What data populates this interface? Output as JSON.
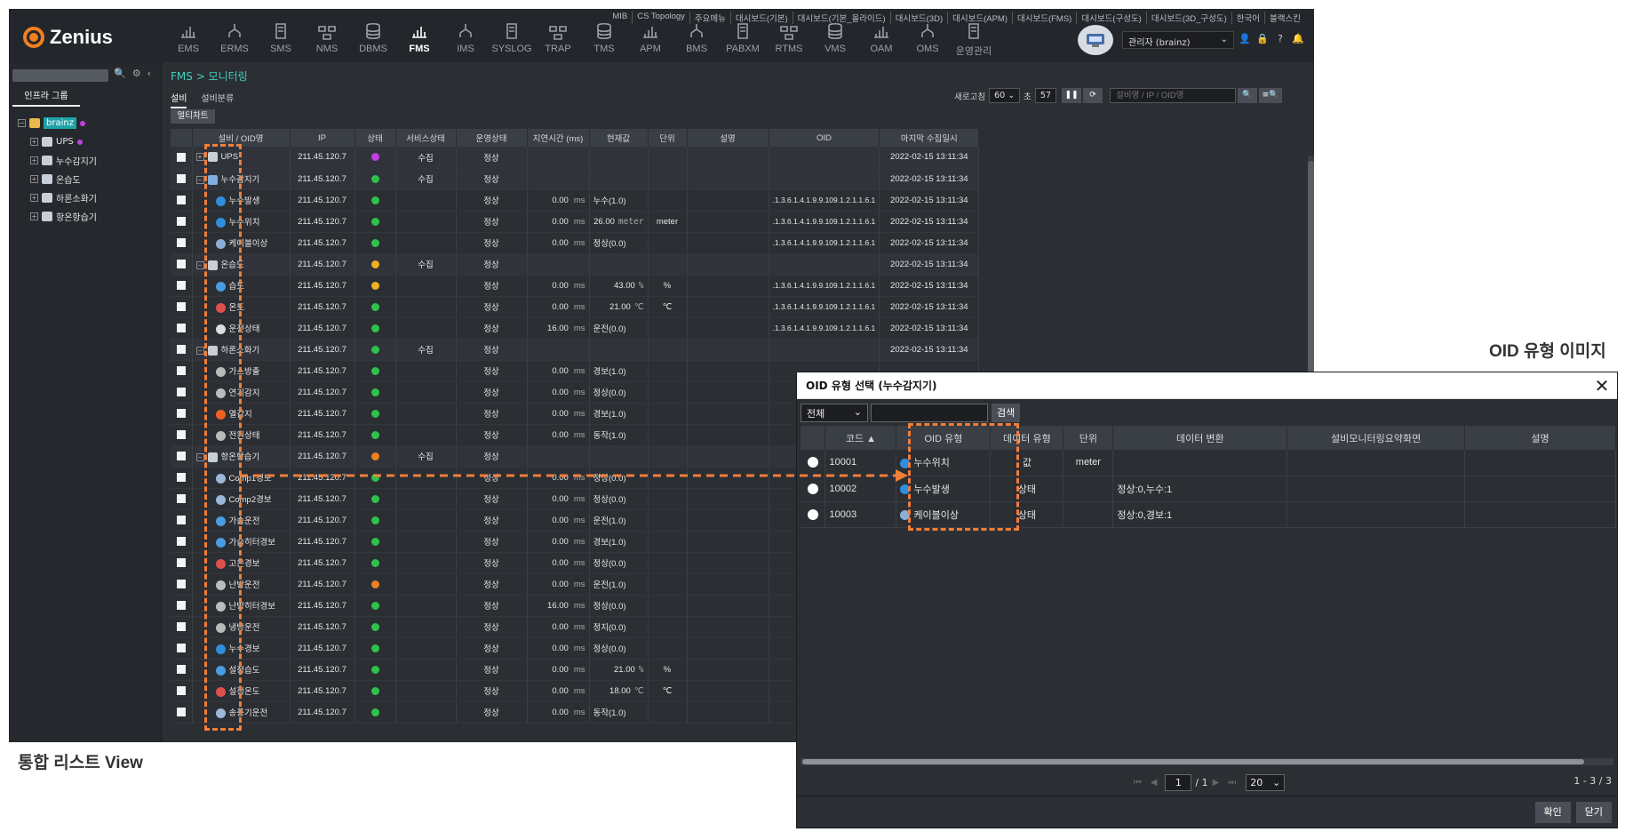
{
  "app": {
    "logo": "Zenius",
    "modules": [
      "EMS",
      "ERMS",
      "SMS",
      "NMS",
      "DBMS",
      "FMS",
      "IMS",
      "SYSLOG",
      "TRAP",
      "TMS",
      "APM",
      "BMS",
      "PABXM",
      "RTMS",
      "VMS",
      "OAM",
      "OMS",
      "운영관리"
    ],
    "active_module": "FMS",
    "top_links": [
      "MIB",
      "CS Topology",
      "주요메뉴",
      "대시보드(기본)",
      "대시보드(기본_올라이드)",
      "대시보드(3D)",
      "대시보드(APM)",
      "대시보드(FMS)",
      "대시보드(구성도)",
      "대시보드(3D_구성도)",
      "한국어",
      "블랙스킨"
    ],
    "user": "관리자 (brainz)"
  },
  "left_panel": {
    "tab": "인프라 그룹",
    "tree": [
      {
        "label": "brainz",
        "level": 0,
        "selected": true
      },
      {
        "label": "UPS",
        "level": 1
      },
      {
        "label": "누수감지기",
        "level": 1
      },
      {
        "label": "온습도",
        "level": 1
      },
      {
        "label": "하론소화기",
        "level": 1
      },
      {
        "label": "항온항습기",
        "level": 1
      }
    ]
  },
  "main": {
    "breadcrumb": "FMS > 모니터링",
    "tabs": [
      "설비",
      "설비분류"
    ],
    "refresh_label": "새로고침",
    "refresh_value": "60",
    "refresh_unit": "초",
    "countdown": "57",
    "search_placeholder": "설비명 / IP / OID명",
    "multichart": "멀티차트",
    "columns": [
      "설비 / OID명",
      "IP",
      "상태",
      "서비스상태",
      "운영상태",
      "지연시간 (ms)",
      "현재값",
      "단위",
      "설명",
      "OID",
      "마지막 수집일시"
    ],
    "rows": [
      {
        "name": "UPS",
        "grp": true,
        "ip": "211.45.120.7",
        "status": "#c040e0",
        "svc": "수집",
        "op": "정상",
        "delay": "",
        "val": "",
        "unit": "",
        "oid": "",
        "time": "2022-02-15 13:11:34",
        "icon": "#c8cfd6"
      },
      {
        "name": "누수감지기",
        "grp": true,
        "ip": "211.45.120.7",
        "status": "#2ec24a",
        "svc": "수집",
        "op": "정상",
        "delay": "",
        "val": "",
        "unit": "",
        "oid": "",
        "time": "2022-02-15 13:11:34",
        "icon": "#7fb0e0"
      },
      {
        "name": "누수발생",
        "grp": false,
        "ip": "211.45.120.7",
        "status": "#2ec24a",
        "svc": "",
        "op": "정상",
        "delay": "0.00",
        "val": "누수(1.0)",
        "unit": "",
        "oid": ".1.3.6.1.4.1.9.9.109.1.2.1.1.6.1",
        "time": "2022-02-15 13:11:34",
        "icon": "#2e8fe0"
      },
      {
        "name": "누수위치",
        "grp": false,
        "ip": "211.45.120.7",
        "status": "#2ec24a",
        "svc": "",
        "op": "정상",
        "delay": "0.00",
        "val": "26.00",
        "valunit": "meter",
        "unit": "meter",
        "oid": ".1.3.6.1.4.1.9.9.109.1.2.1.1.6.1",
        "time": "2022-02-15 13:11:34",
        "icon": "#2e8fe0"
      },
      {
        "name": "케이블이상",
        "grp": false,
        "ip": "211.45.120.7",
        "status": "#2ec24a",
        "svc": "",
        "op": "정상",
        "delay": "0.00",
        "val": "정상(0.0)",
        "unit": "",
        "oid": ".1.3.6.1.4.1.9.9.109.1.2.1.1.6.1",
        "time": "2022-02-15 13:11:34",
        "icon": "#8ab0d8"
      },
      {
        "name": "온습도",
        "grp": true,
        "ip": "211.45.120.7",
        "status": "#f0b020",
        "svc": "수집",
        "op": "정상",
        "delay": "",
        "val": "",
        "unit": "",
        "oid": "",
        "time": "2022-02-15 13:11:34",
        "icon": "#c8cfd6"
      },
      {
        "name": "습도",
        "grp": false,
        "ip": "211.45.120.7",
        "status": "#f0b020",
        "svc": "",
        "op": "정상",
        "delay": "0.00",
        "val": "43.00",
        "valunit": "%",
        "unit": "%",
        "oid": ".1.3.6.1.4.1.9.9.109.1.2.1.1.6.1",
        "time": "2022-02-15 13:11:34",
        "icon": "#4a9ce0"
      },
      {
        "name": "온도",
        "grp": false,
        "ip": "211.45.120.7",
        "status": "#2ec24a",
        "svc": "",
        "op": "정상",
        "delay": "0.00",
        "val": "21.00",
        "valunit": "℃",
        "unit": "℃",
        "oid": ".1.3.6.1.4.1.9.9.109.1.2.1.1.6.1",
        "time": "2022-02-15 13:11:34",
        "icon": "#e05050"
      },
      {
        "name": "운전상태",
        "grp": false,
        "ip": "211.45.120.7",
        "status": "#2ec24a",
        "svc": "",
        "op": "정상",
        "delay": "16.00",
        "val": "운전(0.0)",
        "unit": "",
        "oid": ".1.3.6.1.4.1.9.9.109.1.2.1.1.6.1",
        "time": "2022-02-15 13:11:34",
        "icon": "#dddddd"
      },
      {
        "name": "하론소화기",
        "grp": true,
        "ip": "211.45.120.7",
        "status": "#2ec24a",
        "svc": "수집",
        "op": "정상",
        "delay": "",
        "val": "",
        "unit": "",
        "oid": "",
        "time": "2022-02-15 13:11:34",
        "icon": "#c8cfd6"
      },
      {
        "name": "가스방출",
        "grp": false,
        "ip": "211.45.120.7",
        "status": "#2ec24a",
        "svc": "",
        "op": "정상",
        "delay": "0.00",
        "val": "경보(1.0)",
        "unit": "",
        "oid": "",
        "time": "",
        "icon": "#bbbbbb"
      },
      {
        "name": "연기감지",
        "grp": false,
        "ip": "211.45.120.7",
        "status": "#2ec24a",
        "svc": "",
        "op": "정상",
        "delay": "0.00",
        "val": "정상(0.0)",
        "unit": "",
        "oid": "",
        "time": "",
        "icon": "#bbbbbb"
      },
      {
        "name": "열감지",
        "grp": false,
        "ip": "211.45.120.7",
        "status": "#2ec24a",
        "svc": "",
        "op": "정상",
        "delay": "0.00",
        "val": "경보(1.0)",
        "unit": "",
        "oid": "",
        "time": "",
        "icon": "#f06020"
      },
      {
        "name": "전원상태",
        "grp": false,
        "ip": "211.45.120.7",
        "status": "#2ec24a",
        "svc": "",
        "op": "정상",
        "delay": "0.00",
        "val": "동작(1.0)",
        "unit": "",
        "oid": "",
        "time": "",
        "icon": "#bbbbbb"
      },
      {
        "name": "항온항습기",
        "grp": true,
        "ip": "211.45.120.7",
        "status": "#f07f1f",
        "svc": "수집",
        "op": "정상",
        "delay": "",
        "val": "",
        "unit": "",
        "oid": "",
        "time": "",
        "icon": "#c8cfd6"
      },
      {
        "name": "Comp1경보",
        "grp": false,
        "ip": "211.45.120.7",
        "status": "#2ec24a",
        "svc": "",
        "op": "정상",
        "delay": "0.00",
        "val": "정상(0.0)",
        "unit": "",
        "oid": "",
        "time": "",
        "icon": "#9ab8d8"
      },
      {
        "name": "Comp2경보",
        "grp": false,
        "ip": "211.45.120.7",
        "status": "#2ec24a",
        "svc": "",
        "op": "정상",
        "delay": "0.00",
        "val": "정상(0.0)",
        "unit": "",
        "oid": "",
        "time": "",
        "icon": "#9ab8d8"
      },
      {
        "name": "가습운전",
        "grp": false,
        "ip": "211.45.120.7",
        "status": "#2ec24a",
        "svc": "",
        "op": "정상",
        "delay": "0.00",
        "val": "운전(1.0)",
        "unit": "",
        "oid": "",
        "time": "",
        "icon": "#4a9ce0"
      },
      {
        "name": "가습히터경보",
        "grp": false,
        "ip": "211.45.120.7",
        "status": "#2ec24a",
        "svc": "",
        "op": "정상",
        "delay": "0.00",
        "val": "경보(1.0)",
        "unit": "",
        "oid": "",
        "time": "",
        "icon": "#4a9ce0"
      },
      {
        "name": "고온경보",
        "grp": false,
        "ip": "211.45.120.7",
        "status": "#2ec24a",
        "svc": "",
        "op": "정상",
        "delay": "0.00",
        "val": "정상(0.0)",
        "unit": "",
        "oid": "",
        "time": "",
        "icon": "#e05050"
      },
      {
        "name": "난방운전",
        "grp": false,
        "ip": "211.45.120.7",
        "status": "#f07f1f",
        "svc": "",
        "op": "정상",
        "delay": "0.00",
        "val": "운전(1.0)",
        "unit": "",
        "oid": "",
        "time": "",
        "icon": "#bbbbbb"
      },
      {
        "name": "난방히터경보",
        "grp": false,
        "ip": "211.45.120.7",
        "status": "#2ec24a",
        "svc": "",
        "op": "정상",
        "delay": "16.00",
        "val": "정상(0.0)",
        "unit": "",
        "oid": "",
        "time": "",
        "icon": "#bbbbbb"
      },
      {
        "name": "냉방운전",
        "grp": false,
        "ip": "211.45.120.7",
        "status": "#2ec24a",
        "svc": "",
        "op": "정상",
        "delay": "0.00",
        "val": "정지(0.0)",
        "unit": "",
        "oid": "",
        "time": "",
        "icon": "#bbbbbb"
      },
      {
        "name": "누수경보",
        "grp": false,
        "ip": "211.45.120.7",
        "status": "#2ec24a",
        "svc": "",
        "op": "정상",
        "delay": "0.00",
        "val": "정상(0.0)",
        "unit": "",
        "oid": "",
        "time": "",
        "icon": "#2e8fe0"
      },
      {
        "name": "설정습도",
        "grp": false,
        "ip": "211.45.120.7",
        "status": "#2ec24a",
        "svc": "",
        "op": "정상",
        "delay": "0.00",
        "val": "21.00",
        "valunit": "%",
        "unit": "%",
        "oid": "",
        "time": "",
        "icon": "#4a9ce0"
      },
      {
        "name": "설정온도",
        "grp": false,
        "ip": "211.45.120.7",
        "status": "#2ec24a",
        "svc": "",
        "op": "정상",
        "delay": "0.00",
        "val": "18.00",
        "valunit": "℃",
        "unit": "℃",
        "oid": "",
        "time": "",
        "icon": "#e05050"
      },
      {
        "name": "송풍기운전",
        "grp": false,
        "ip": "211.45.120.7",
        "status": "#2ec24a",
        "svc": "",
        "op": "정상",
        "delay": "0.00",
        "val": "동작(1.0)",
        "unit": "",
        "oid": "",
        "time": "",
        "icon": "#9ab8d8"
      }
    ],
    "delay_unit": "ms"
  },
  "labels": {
    "left": "통합 리스트 View",
    "right": "OID 유형 이미지"
  },
  "dialog": {
    "title": "OID 유형 선택 (누수감지기)",
    "filter": "전체",
    "search_btn": "검색",
    "columns": [
      "코드 ▲",
      "OID 유형",
      "데이터 유형",
      "단위",
      "데이터 변환",
      "설비모니터링요약화면",
      "설명"
    ],
    "rows": [
      {
        "code": "10001",
        "type": "누수위치",
        "dtype": "값",
        "unit": "meter",
        "conv": "",
        "icon": "#2e8fe0"
      },
      {
        "code": "10002",
        "type": "누수발생",
        "dtype": "상태",
        "unit": "",
        "conv": "정상:0,누수:1",
        "icon": "#2e8fe0"
      },
      {
        "code": "10003",
        "type": "케이블이상",
        "dtype": "상태",
        "unit": "",
        "conv": "정상:0,경보:1",
        "icon": "#8ab0d8"
      }
    ],
    "page": "1",
    "pages": "/ 1",
    "page_size": "20",
    "count": "1 - 3 / 3",
    "ok": "확인",
    "close": "닫기"
  }
}
